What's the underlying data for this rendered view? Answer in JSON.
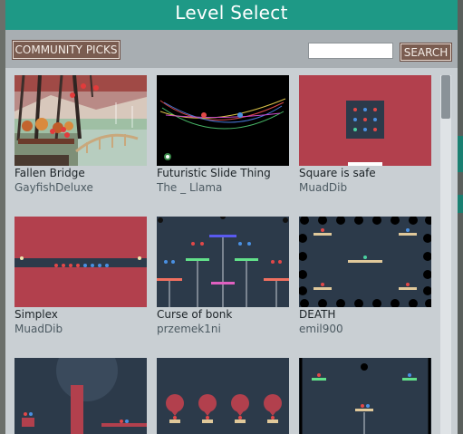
{
  "dialog": {
    "title": "Level Select",
    "community_label": "COMMUNITY PICKS",
    "search_placeholder": "",
    "search_label": "SEARCH"
  },
  "levels": [
    {
      "name": "Fallen Bridge",
      "author": "GayfishDeluxe"
    },
    {
      "name": "Futuristic Slide Thing",
      "author": "The _ Llama"
    },
    {
      "name": "Square is safe",
      "author": "MuadDib"
    },
    {
      "name": "Simplex",
      "author": "MuadDib"
    },
    {
      "name": "Curse of bonk",
      "author": "przemek1ni"
    },
    {
      "name": "DEATH",
      "author": "emil900"
    },
    {
      "name": "",
      "author": ""
    },
    {
      "name": "",
      "author": ""
    },
    {
      "name": "",
      "author": ""
    }
  ],
  "colors": {
    "title_bar": "#1e9986",
    "button": "#7a5c50",
    "panel": "#c9cfd3",
    "level_red": "#b2404d",
    "level_navy": "#2c3a4a"
  }
}
